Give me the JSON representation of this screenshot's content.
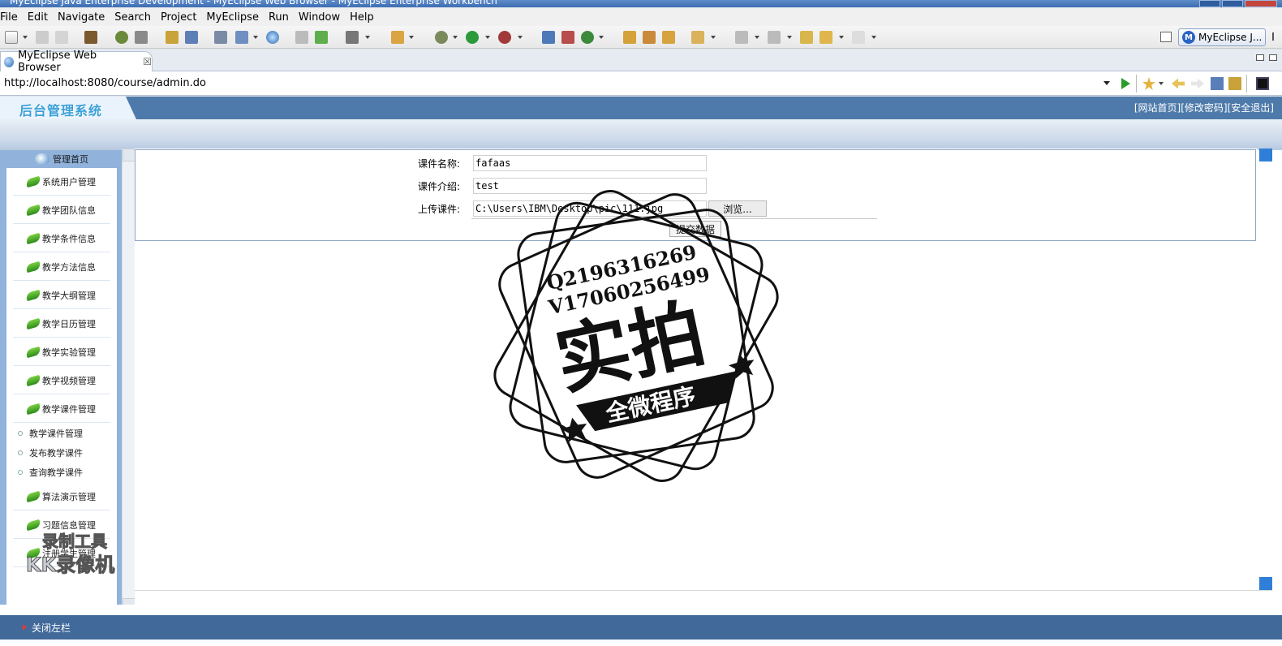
{
  "window": {
    "title": "MyEclipse Java Enterprise Development - MyEclipse Web Browser - MyEclipse Enterprise Workbench"
  },
  "menu": [
    "File",
    "Edit",
    "Navigate",
    "Search",
    "Project",
    "MyEclipse",
    "Run",
    "Window",
    "Help"
  ],
  "toolbar": {
    "perspective_label": "MyEclipse J..."
  },
  "editor_tab": {
    "label": "MyEclipse Web Browser",
    "close": "☒"
  },
  "browser": {
    "url": "http://localhost:8080/course/admin.do"
  },
  "site": {
    "logo": "后台管理系统",
    "header_links": [
      "[网站首页]",
      "[修改密码]",
      "[安全退出]"
    ],
    "sidebar_title": "管理首页",
    "menu_items": [
      "系统用户管理",
      "教学团队信息",
      "教学条件信息",
      "教学方法信息",
      "教学大纲管理",
      "教学日历管理",
      "教学实验管理",
      "教学视频管理",
      "教学课件管理"
    ],
    "sub_items": [
      "教学课件管理",
      "发布教学课件",
      "查询教学课件"
    ],
    "menu_items_after": [
      "算法演示管理",
      "习题信息管理",
      "注册学生管理"
    ],
    "footer": "关闭左栏"
  },
  "form": {
    "name_label": "课件名称:",
    "name_value": "fafaas",
    "intro_label": "课件介绍:",
    "intro_value": "test",
    "upload_label": "上传课件:",
    "upload_value": "C:\\Users\\IBM\\Desktop\\pic\\111.jpg",
    "browse_label": "浏览...",
    "submit_label": "提交数据"
  },
  "watermark": {
    "line1": "Q2196316269",
    "line2": "V17060256499",
    "big": "实拍",
    "banner": "全微程序"
  },
  "recorder_watermark": {
    "line1": "录制工具",
    "line2": "KK录像机"
  }
}
